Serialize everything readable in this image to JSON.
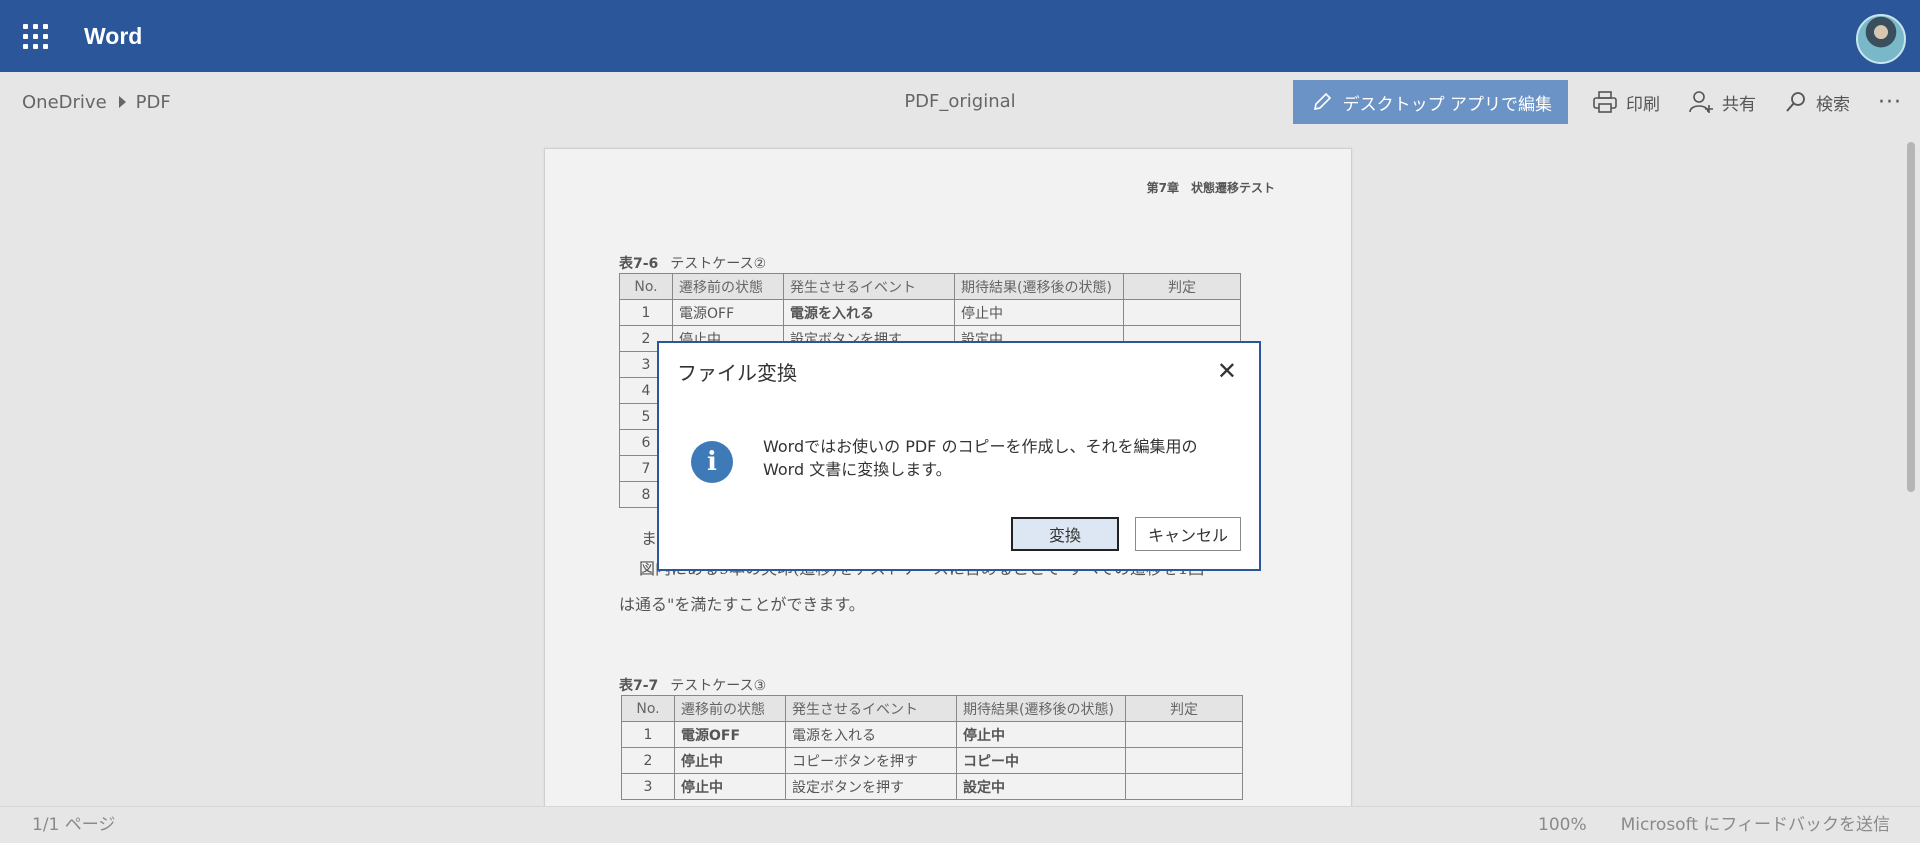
{
  "suite": {
    "app_name": "Word"
  },
  "breadcrumb": {
    "root": "OneDrive",
    "folder": "PDF"
  },
  "document": {
    "title": "PDF_original"
  },
  "commands": {
    "edit_desktop": "デスクトップ アプリで編集",
    "print": "印刷",
    "share": "共有",
    "search": "検索",
    "more": "···"
  },
  "page": {
    "chapter_header": "第7章　状態遷移テスト",
    "table1": {
      "caption_num": "表7-6",
      "caption_title": "テストケース②",
      "headers": [
        "No.",
        "遷移前の状態",
        "発生させるイベント",
        "期待結果(遷移後の状態)",
        "判定"
      ],
      "rows": [
        [
          "1",
          "電源OFF",
          "電源を入れる",
          "停止中",
          ""
        ],
        [
          "2",
          "停止中",
          "設定ボタンを押す",
          "設定中",
          ""
        ],
        [
          "3",
          "",
          "",
          "",
          ""
        ],
        [
          "4",
          "",
          "",
          "",
          ""
        ],
        [
          "5",
          "",
          "",
          "",
          ""
        ],
        [
          "6",
          "",
          "",
          "",
          ""
        ],
        [
          "7",
          "",
          "",
          "",
          ""
        ],
        [
          "8",
          "",
          "",
          "",
          ""
        ]
      ]
    },
    "text_line0": "ま",
    "text_line1": "図内にある9本の矢印(遷移)をテストケースに含めることで\"すべての遷移を1回",
    "text_line2": "は通る\"を満たすことができます。",
    "table2": {
      "caption_num": "表7-7",
      "caption_title": "テストケース③",
      "headers": [
        "No.",
        "遷移前の状態",
        "発生させるイベント",
        "期待結果(遷移後の状態)",
        "判定"
      ],
      "rows": [
        [
          "1",
          "電源OFF",
          "電源を入れる",
          "停止中",
          ""
        ],
        [
          "2",
          "停止中",
          "コピーボタンを押す",
          "コピー中",
          ""
        ],
        [
          "3",
          "停止中",
          "設定ボタンを押す",
          "設定中",
          ""
        ]
      ]
    }
  },
  "dialog": {
    "title": "ファイル変換",
    "close": "✕",
    "info_glyph": "i",
    "message_line1": "Wordではお使いの PDF のコピーを作成し、それを編集用の",
    "message_line2": "Word 文書に変換します。",
    "convert_label": "変換",
    "cancel_label": "キャンセル"
  },
  "status": {
    "page_count": "1/1 ページ",
    "zoom": "100%",
    "feedback": "Microsoft にフィードバックを送信"
  },
  "colors": {
    "suite_bar": "#2b579a",
    "edit_button": "#6b93c6",
    "info_icon": "#3e79b8"
  }
}
